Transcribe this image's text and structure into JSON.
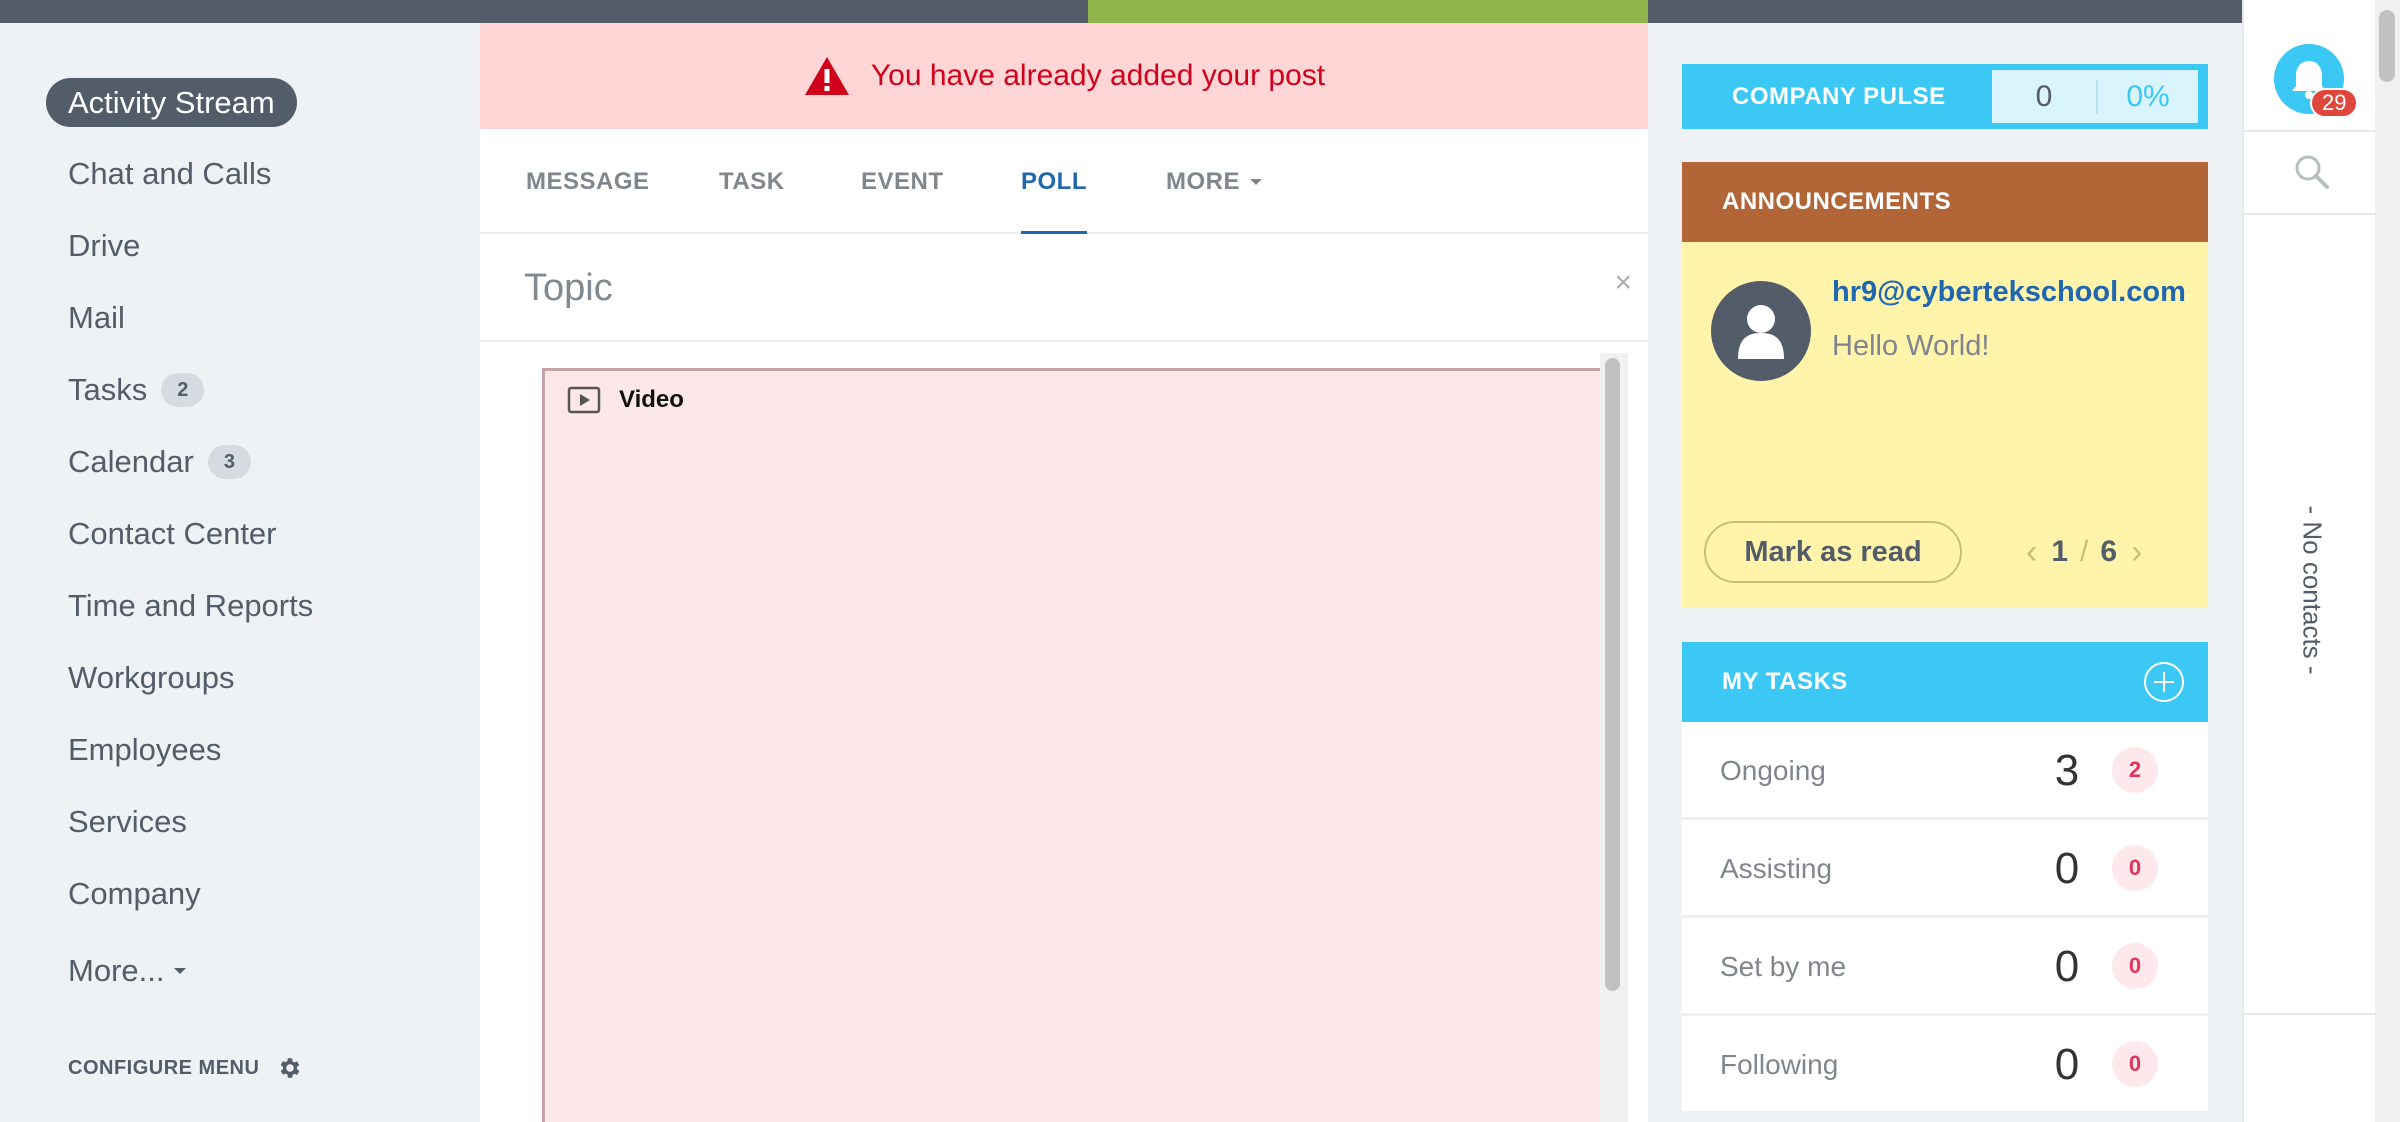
{
  "colors": {
    "brand_blue": "#3bc8f5",
    "dark": "#535c69",
    "alert_red": "#d0021b",
    "announcement_brown": "#b26537",
    "link_blue": "#2067b0"
  },
  "left_menu": {
    "items": [
      {
        "label": "Activity Stream",
        "active": true
      },
      {
        "label": "Chat and Calls"
      },
      {
        "label": "Drive"
      },
      {
        "label": "Mail"
      },
      {
        "label": "Tasks",
        "badge": "2"
      },
      {
        "label": "Calendar",
        "badge": "3"
      },
      {
        "label": "Contact Center"
      },
      {
        "label": "Time and Reports"
      },
      {
        "label": "Workgroups"
      },
      {
        "label": "Employees"
      },
      {
        "label": "Services"
      },
      {
        "label": "Company"
      },
      {
        "label": "More..."
      }
    ],
    "configure_label": "CONFIGURE MENU"
  },
  "alert": {
    "icon": "warning-triangle-icon",
    "text": "You have already added your post"
  },
  "composer": {
    "tabs": [
      {
        "label": "MESSAGE"
      },
      {
        "label": "TASK"
      },
      {
        "label": "EVENT"
      },
      {
        "label": "POLL",
        "active": true
      },
      {
        "label": "MORE"
      }
    ],
    "topic_placeholder": "Topic",
    "close_glyph": "×",
    "video_label": "Video"
  },
  "company_pulse": {
    "label": "COMPANY PULSE",
    "value": "0",
    "percent": "0%"
  },
  "announcements": {
    "title": "ANNOUNCEMENTS",
    "author": "hr9@cybertekschool.com",
    "text": "Hello World!",
    "mark_read": "Mark as read",
    "page_current": "1",
    "page_sep": "/",
    "page_total": "6"
  },
  "my_tasks": {
    "title": "MY TASKS",
    "rows": [
      {
        "label": "Ongoing",
        "count": "3",
        "badge": "2"
      },
      {
        "label": "Assisting",
        "count": "0",
        "badge": "0"
      },
      {
        "label": "Set by me",
        "count": "0",
        "badge": "0"
      },
      {
        "label": "Following",
        "count": "0",
        "badge": "0"
      }
    ]
  },
  "sidebar_right": {
    "notifications": "29",
    "no_contacts": "- No contacts -"
  }
}
